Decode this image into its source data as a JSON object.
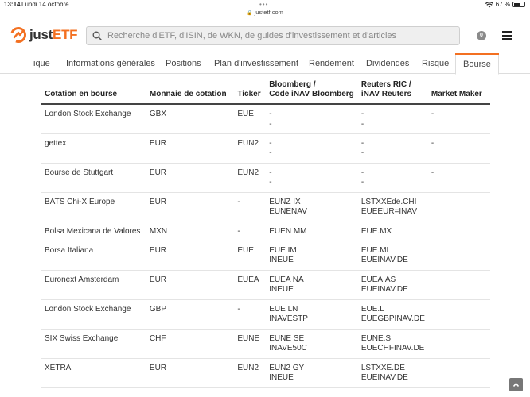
{
  "status": {
    "time": "13:14",
    "date": "Lundi 14 octobre",
    "battery": "67 %",
    "battery_level": 0.67
  },
  "browser": {
    "url": "justetf.com"
  },
  "header": {
    "logo_just": "just",
    "logo_etf": "ETF",
    "search_placeholder": "Recherche d'ETF, d'ISIN, de WKN, de guides d'investissement et d'articles",
    "notification_count": "0"
  },
  "tabs": [
    {
      "label": "ique"
    },
    {
      "label": "Informations générales"
    },
    {
      "label": "Positions"
    },
    {
      "label": "Plan d'investissement"
    },
    {
      "label": "Rendement"
    },
    {
      "label": "Dividendes"
    },
    {
      "label": "Risque"
    },
    {
      "label": "Bourse",
      "active": true
    }
  ],
  "table": {
    "headers": {
      "exchange": "Cotation en bourse",
      "currency": "Monnaie de cotation",
      "ticker": "Ticker",
      "bloomberg_1": "Bloomberg /",
      "bloomberg_2": "Code iNAV Bloomberg",
      "reuters_1": "Reuters RIC /",
      "reuters_2": "iNAV Reuters",
      "market_maker": "Market Maker"
    },
    "rows": [
      {
        "exchange": "London Stock Exchange",
        "currency": "GBX",
        "ticker": "EUE",
        "bloomberg": [
          "-",
          "-"
        ],
        "reuters": [
          "-",
          "-"
        ],
        "market_maker": "-"
      },
      {
        "exchange": "gettex",
        "currency": "EUR",
        "ticker": "EUN2",
        "bloomberg": [
          "-",
          "-"
        ],
        "reuters": [
          "-",
          "-"
        ],
        "market_maker": "-"
      },
      {
        "exchange": "Bourse de Stuttgart",
        "currency": "EUR",
        "ticker": "EUN2",
        "bloomberg": [
          "-",
          "-"
        ],
        "reuters": [
          "-",
          "-"
        ],
        "market_maker": "-"
      },
      {
        "exchange": "BATS Chi-X Europe",
        "currency": "EUR",
        "ticker": "-",
        "bloomberg": [
          "EUNZ IX",
          "EUNENAV"
        ],
        "reuters": [
          "LSTXXEde.CHI",
          "EUEEUR=INAV"
        ],
        "market_maker": ""
      },
      {
        "exchange": "Bolsa Mexicana de Valores",
        "currency": "MXN",
        "ticker": "-",
        "bloomberg": [
          "EUEN MM"
        ],
        "reuters": [
          "EUE.MX"
        ],
        "market_maker": ""
      },
      {
        "exchange": "Borsa Italiana",
        "currency": "EUR",
        "ticker": "EUE",
        "bloomberg": [
          "EUE IM",
          "INEUE"
        ],
        "reuters": [
          "EUE.MI",
          "EUEINAV.DE"
        ],
        "market_maker": ""
      },
      {
        "exchange": "Euronext Amsterdam",
        "currency": "EUR",
        "ticker": "EUEA",
        "bloomberg": [
          "EUEA NA",
          "INEUE"
        ],
        "reuters": [
          "EUEA.AS",
          "EUEINAV.DE"
        ],
        "market_maker": ""
      },
      {
        "exchange": "London Stock Exchange",
        "currency": "GBP",
        "ticker": "-",
        "bloomberg": [
          "EUE LN",
          "INAVESTP"
        ],
        "reuters": [
          "EUE.L",
          "EUEGBPINAV.DE"
        ],
        "market_maker": ""
      },
      {
        "exchange": "SIX Swiss Exchange",
        "currency": "CHF",
        "ticker": "EUNE",
        "bloomberg": [
          "EUNE SE",
          "INAVE50C"
        ],
        "reuters": [
          "EUNE.S",
          "EUECHFINAV.DE"
        ],
        "market_maker": ""
      },
      {
        "exchange": "XETRA",
        "currency": "EUR",
        "ticker": "EUN2",
        "bloomberg": [
          "EUN2 GY",
          "INEUE"
        ],
        "reuters": [
          "LSTXXE.DE",
          "EUEINAV.DE"
        ],
        "market_maker": ""
      }
    ]
  },
  "colors": {
    "accent": "#f37021",
    "text": "#333333",
    "border": "#dddddd"
  }
}
